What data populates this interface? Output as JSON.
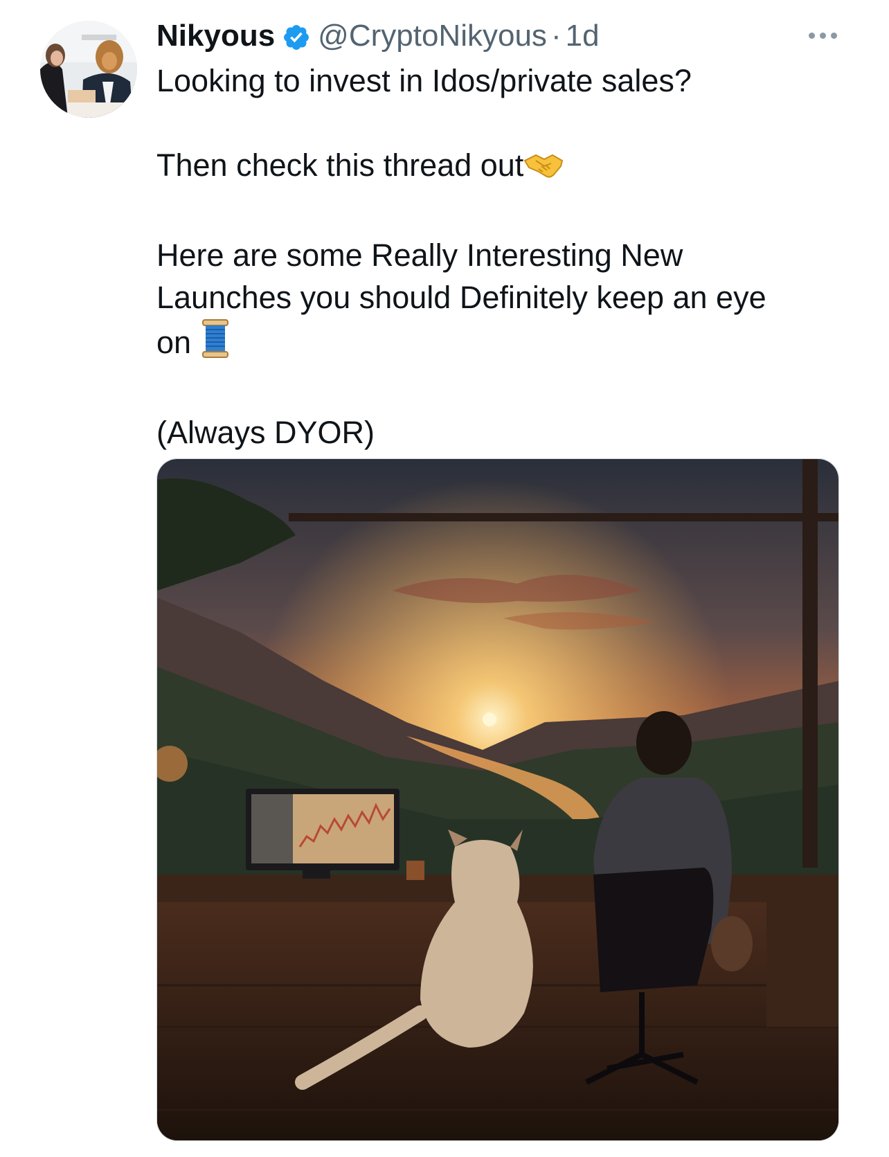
{
  "tweet": {
    "author": {
      "display_name": "Nikyous",
      "verified": true,
      "handle": "@CryptoNikyous",
      "separator": "·",
      "time": "1d"
    },
    "text": {
      "line1": "Looking to invest in Idos/private sales?",
      "line2": "Then check this thread out",
      "line2_emoji": "handshake",
      "line3a": "Here are some Really Interesting New",
      "line3b": "Launches you should Definitely keep an eye",
      "line3c": "on",
      "line3_emoji": "thread-spool",
      "line4": "(Always DYOR)"
    },
    "media": {
      "kind": "image",
      "subject": "man and dog at desk with trading monitor overlooking sunset valley"
    }
  },
  "colors": {
    "text_primary": "#0f1419",
    "text_secondary": "#536471",
    "verified_blue": "#1d9bf0",
    "icon_gray": "#8b98a5"
  },
  "icons": {
    "verified": "verified-badge-icon",
    "more": "more-dots-icon"
  }
}
